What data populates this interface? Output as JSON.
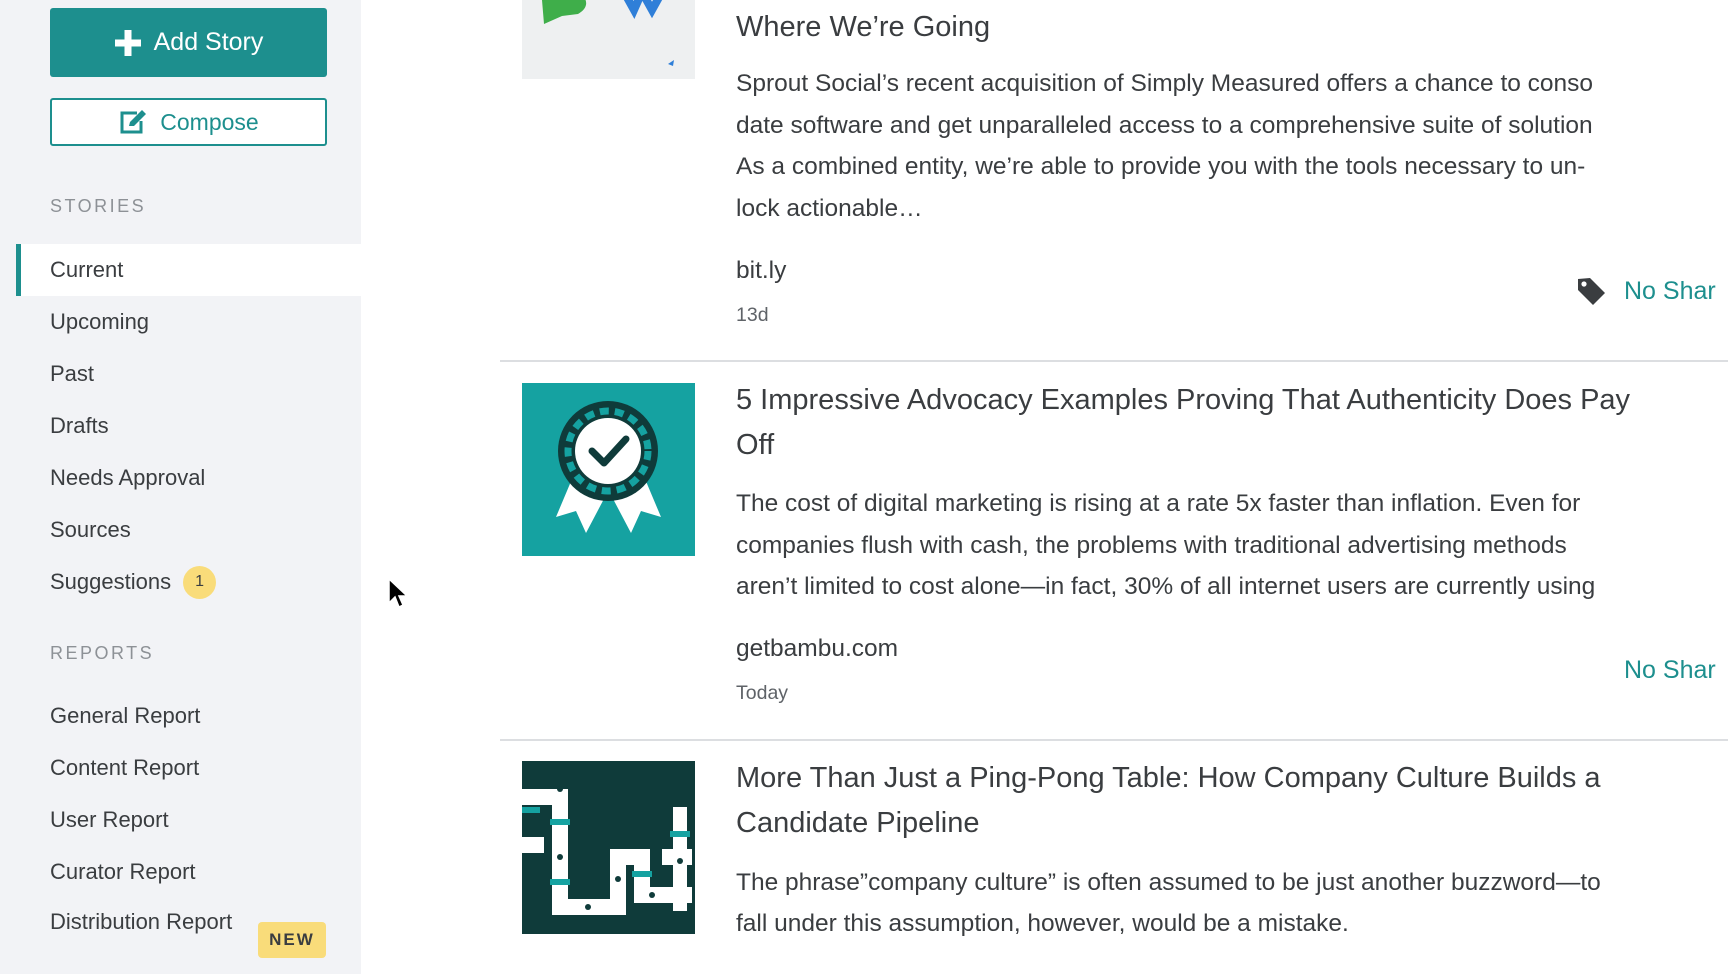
{
  "sidebar": {
    "add_story": "Add Story",
    "compose": "Compose",
    "stories_heading": "STORIES",
    "stories": [
      {
        "label": "Current",
        "active": true
      },
      {
        "label": "Upcoming"
      },
      {
        "label": "Past"
      },
      {
        "label": "Drafts"
      },
      {
        "label": "Needs Approval"
      },
      {
        "label": "Sources"
      },
      {
        "label": "Suggestions",
        "badge": "1"
      }
    ],
    "reports_heading": "REPORTS",
    "reports": [
      {
        "label": "General Report"
      },
      {
        "label": "Content Report"
      },
      {
        "label": "User Report"
      },
      {
        "label": "Curator Report"
      },
      {
        "label": "Distribution Report",
        "badge": "NEW"
      }
    ]
  },
  "stories": [
    {
      "title": "Where We’re Going",
      "excerpt": [
        "Sprout Social’s recent acquisition of Simply Measured offers a chance to conso",
        "date software and get unparalleled access to a comprehensive suite of solution",
        "As a combined entity, we’re able to provide you with the tools necessary to un-",
        "lock actionable…"
      ],
      "source": "bit.ly",
      "time": "13d",
      "share": "No Shar"
    },
    {
      "title_lines": [
        "5 Impressive Advocacy Examples Proving That Authenticity Does Pay",
        "Off"
      ],
      "excerpt": [
        "The cost of digital marketing is rising at a rate 5x faster than inflation. Even for",
        "companies flush with cash, the problems with traditional advertising methods",
        "aren’t limited to cost alone—in fact, 30% of all internet users are currently using"
      ],
      "source": "getbambu.com",
      "time": "Today",
      "share": "No Shar"
    },
    {
      "title_lines": [
        "More Than Just a Ping-Pong Table: How Company Culture Builds a",
        "Candidate Pipeline"
      ],
      "excerpt": [
        "The phrase”company culture” is often assumed to be just another buzzword—to",
        "fall under this assumption, however, would be a mistake."
      ]
    }
  ],
  "colors": {
    "accent": "#1d8f8e",
    "badge": "#f9dc7a",
    "sidebar_bg": "#f2f3f6"
  }
}
